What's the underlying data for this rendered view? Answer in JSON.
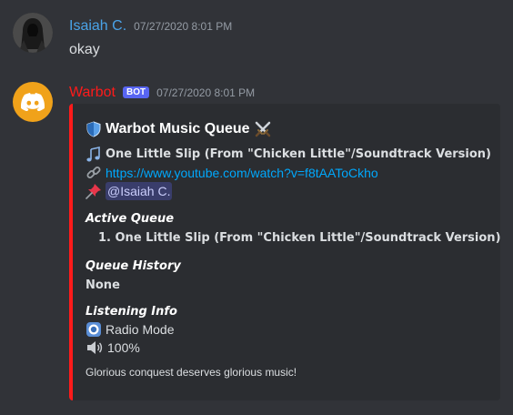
{
  "messages": [
    {
      "username": "Isaiah C.",
      "timestamp": "07/27/2020 8:01 PM",
      "content": "okay"
    },
    {
      "username": "Warbot",
      "bot_tag": "BOT",
      "timestamp": "07/27/2020 8:01 PM",
      "embed": {
        "title": "Warbot Music Queue",
        "track_title": "One Little Slip (From \"Chicken Little\"/Soundtrack Version)",
        "url": "https://www.youtube.com/watch?v=f8tAAToCkho",
        "mention": "@Isaiah C.",
        "active_queue_label": "Active Queue",
        "active_queue_item": "1. One Little Slip (From \"Chicken Little\"/Soundtrack Version)",
        "queue_history_label": "Queue History",
        "queue_history_value": "None",
        "listening_info_label": "Listening Info",
        "radio_mode": "Radio Mode",
        "volume": "100%",
        "footer": "Glorious conquest deserves glorious music!"
      }
    }
  ],
  "colors": {
    "background": "#313338",
    "embed_background": "#2b2d31",
    "embed_accent": "#ff1a1a",
    "user_name": "#4aa3e8",
    "bot_name": "#ff1a1a",
    "link": "#00a8fc",
    "bot_tag": "#5865f2"
  },
  "icons": {
    "user_avatar": "hooded-figure-avatar",
    "bot_avatar": "discord-logo",
    "title_left": "shield-icon",
    "title_right": "crossed-swords-icon",
    "track": "musical-notes-icon",
    "link": "link-icon",
    "requester": "pushpin-icon",
    "radio": "radio-button-icon",
    "volume": "speaker-icon"
  }
}
